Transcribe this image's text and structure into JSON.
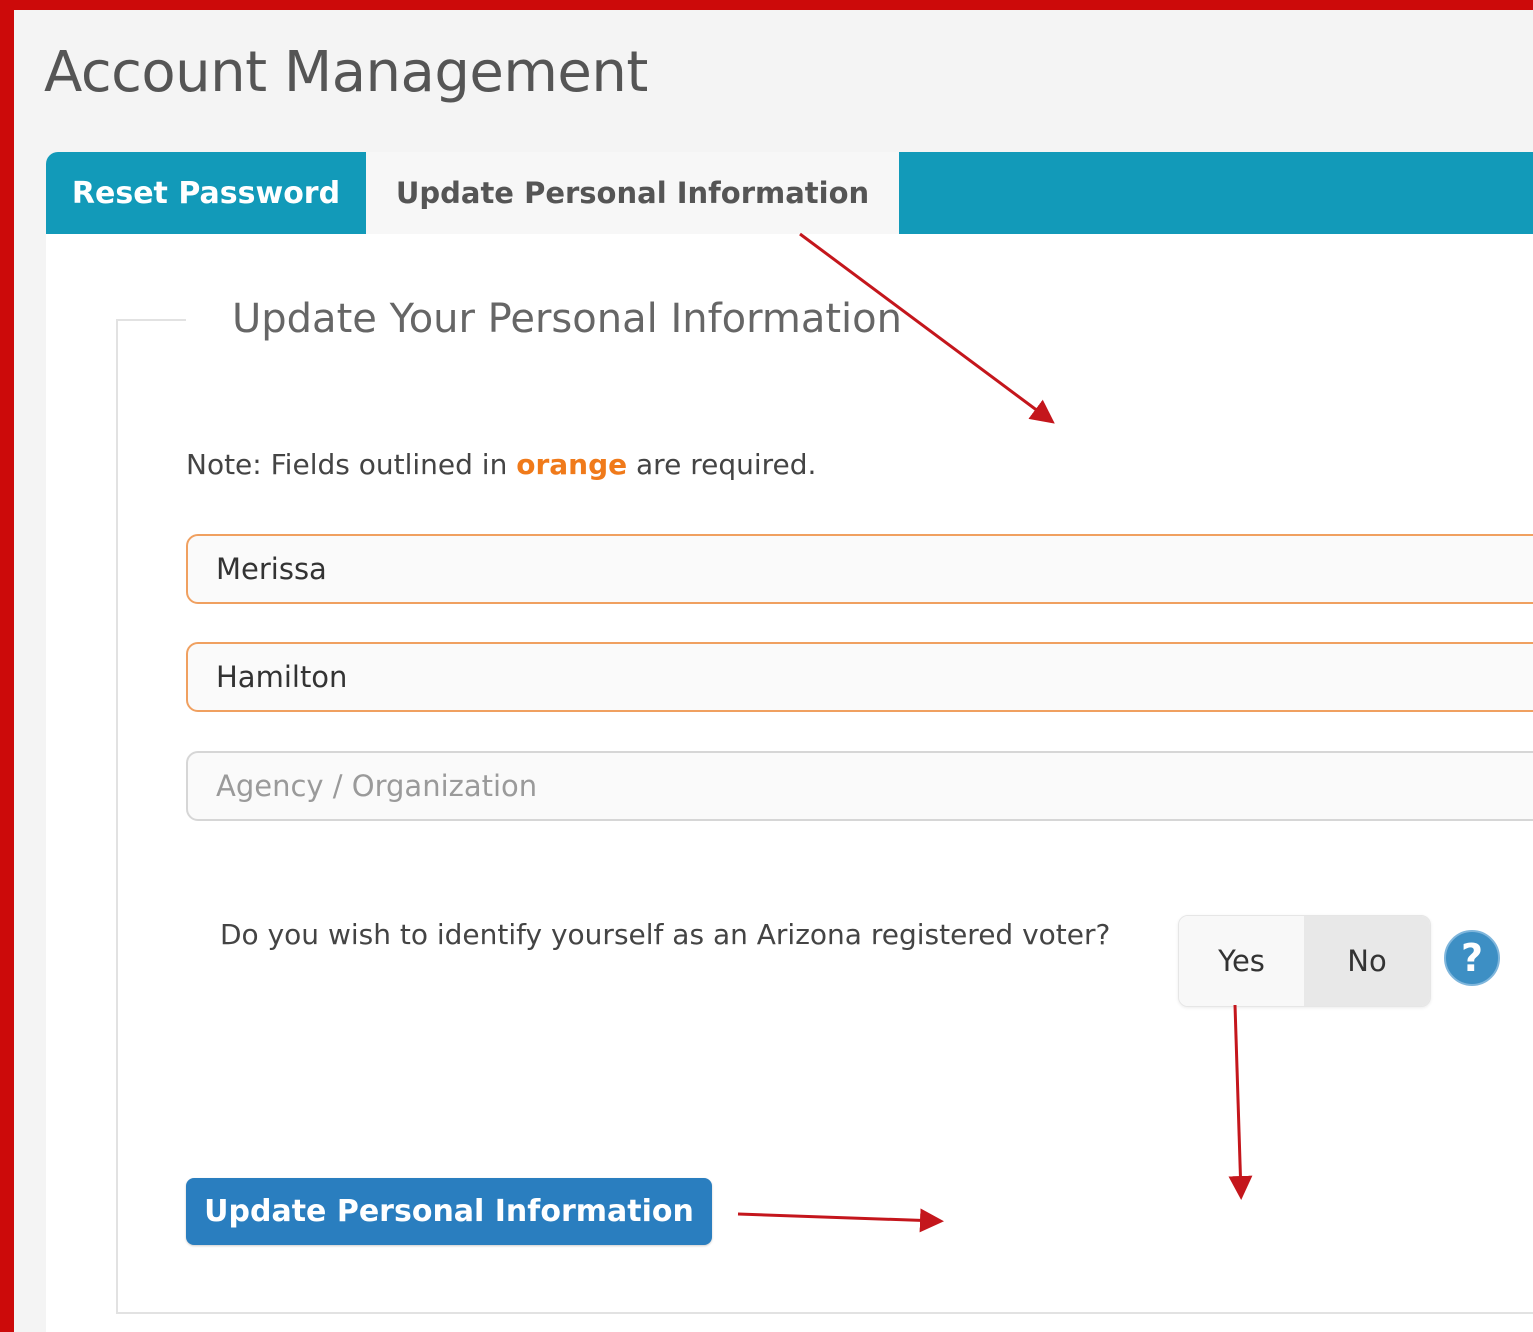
{
  "page": {
    "title": "Account Management"
  },
  "tabs": [
    {
      "label": "Reset Password",
      "active": false
    },
    {
      "label": "Update Personal Information",
      "active": true
    }
  ],
  "form": {
    "legend": "Update Your Personal Information",
    "note": {
      "prefix": "Note: Fields outlined in ",
      "highlight": "orange",
      "suffix": " are required."
    },
    "first_name": {
      "value": "Merissa",
      "required": true
    },
    "last_name": {
      "value": "Hamilton",
      "required": true
    },
    "agency": {
      "value": "",
      "placeholder": "Agency / Organization",
      "required": false
    },
    "voter_question": "Do you wish to identify yourself as an Arizona registered voter?",
    "voter_toggle": {
      "yes_label": "Yes",
      "no_label": "No",
      "selected": "No"
    },
    "help_icon": "question-mark-icon",
    "submit_label": "Update Personal Information"
  },
  "colors": {
    "frame": "#cc0a0a",
    "tab_bar": "#129ab9",
    "required_outline": "#f0a060",
    "note_orange": "#f07a1a",
    "submit_button": "#2a7ebf",
    "annotation_arrow": "#c4161c"
  }
}
